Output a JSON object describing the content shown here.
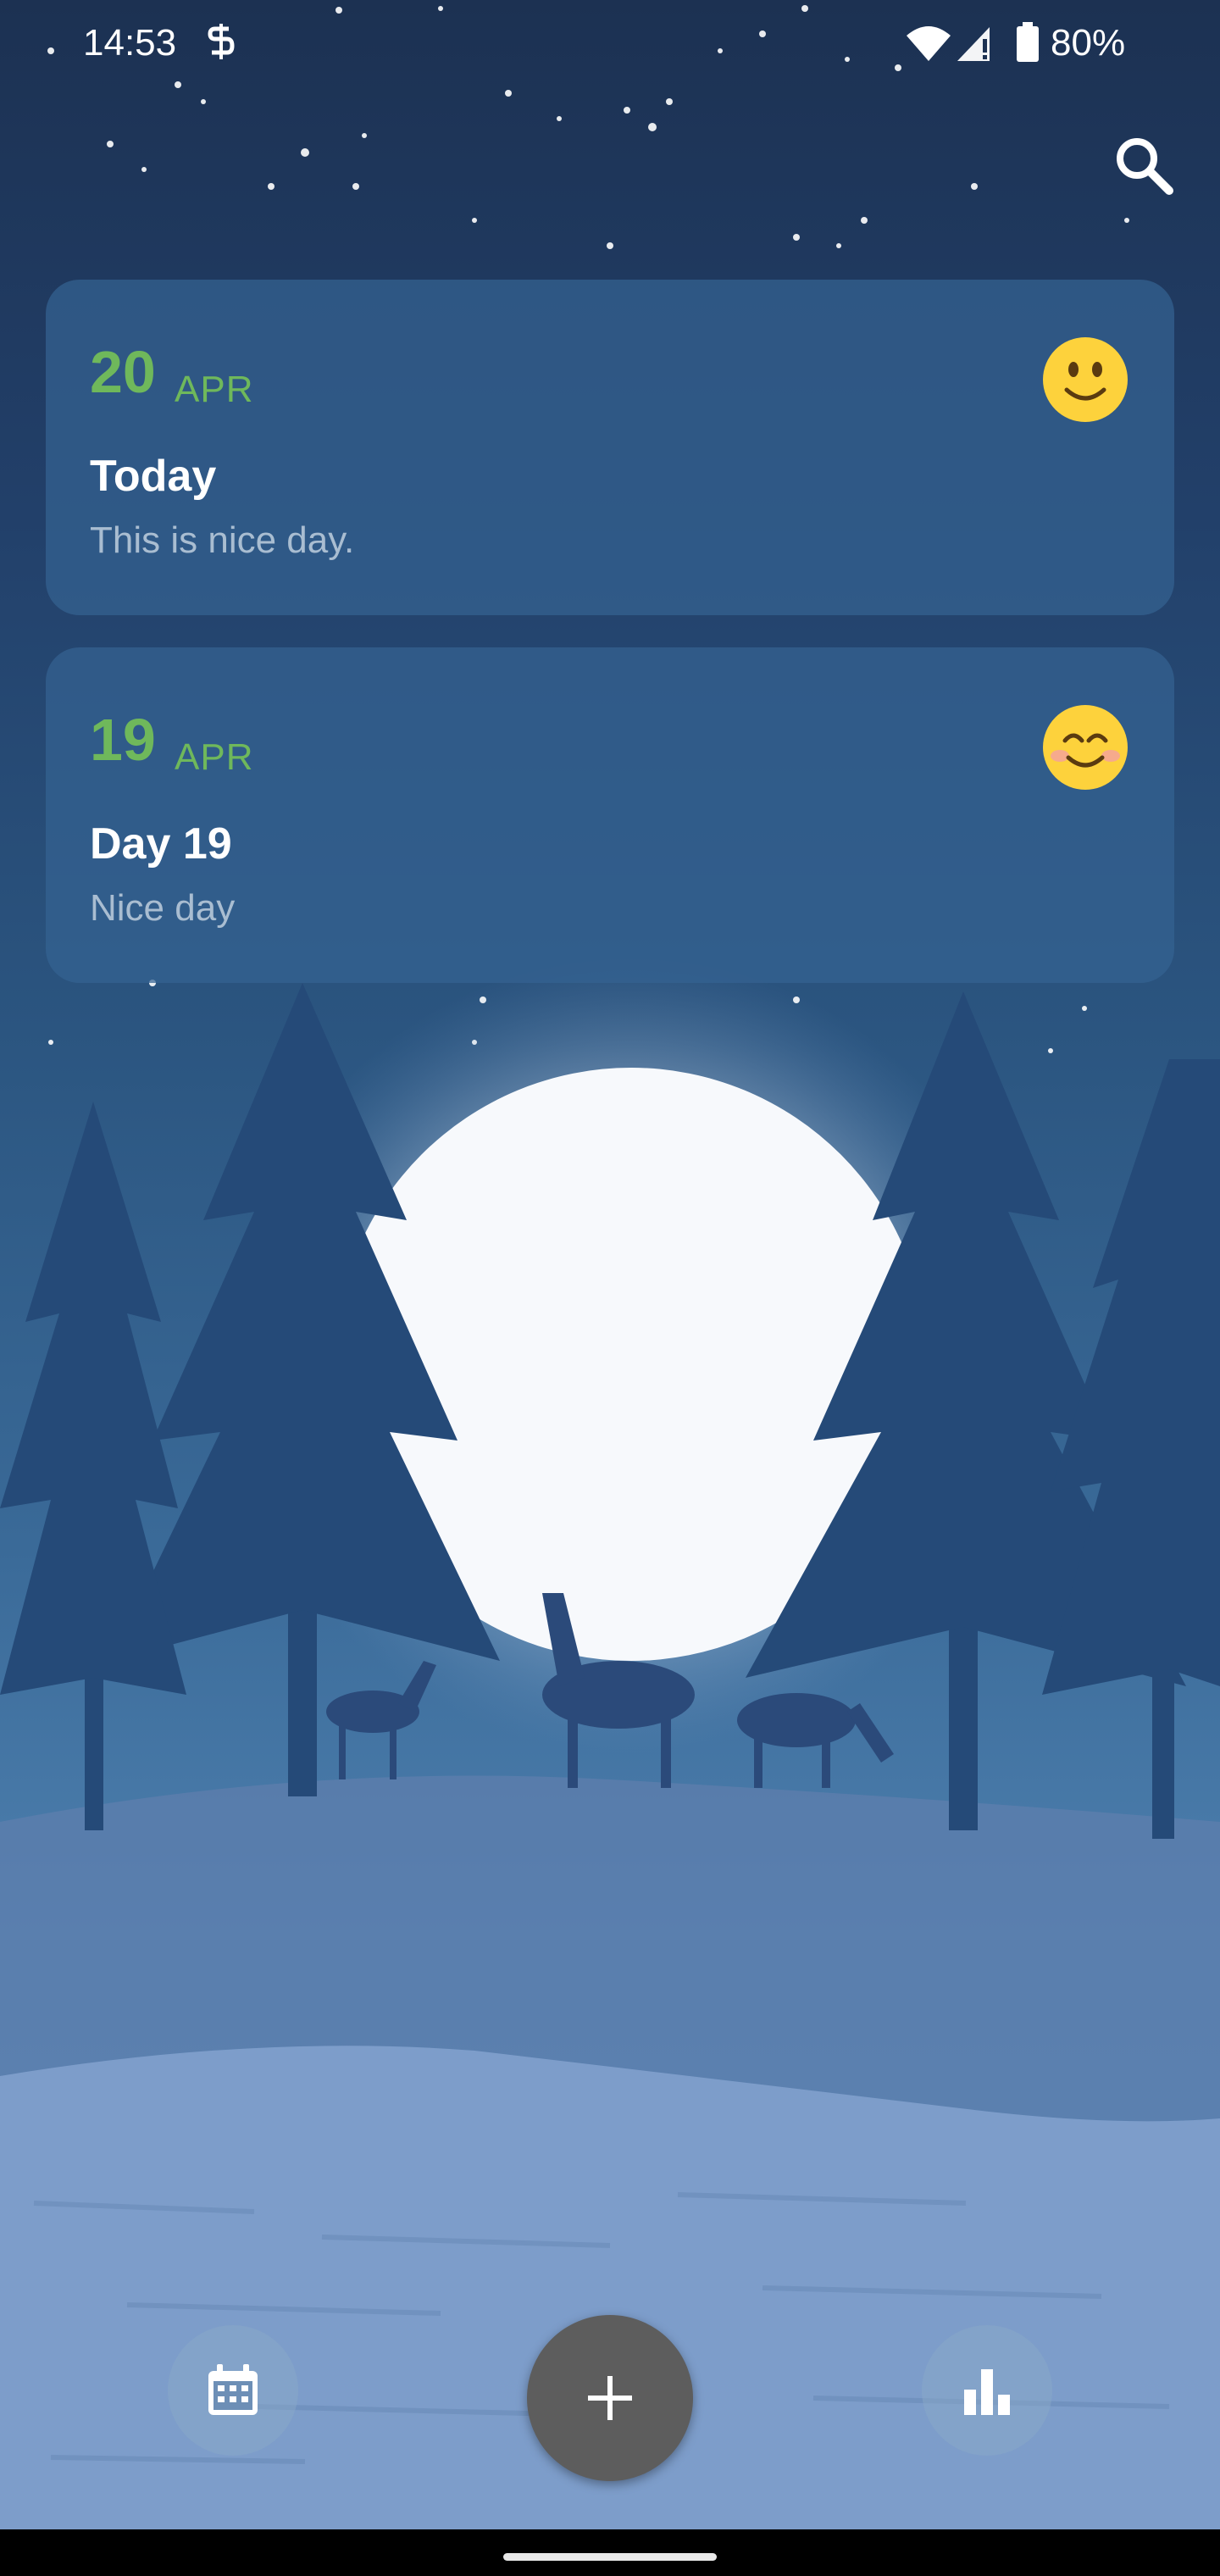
{
  "status_bar": {
    "time": "14:53",
    "battery": "80%"
  },
  "header": {
    "search_icon": "search-icon"
  },
  "entries": [
    {
      "day": "20",
      "month": "APR",
      "title": "Today",
      "body": "This is nice day.",
      "mood_icon": "slightly-smiling-face-icon"
    },
    {
      "day": "19",
      "month": "APR",
      "title": "Day 19",
      "body": "Nice day",
      "mood_icon": "smiling-face-with-smiling-eyes-icon"
    }
  ],
  "bottom_bar": {
    "calendar_icon": "calendar-icon",
    "add_icon": "plus-icon",
    "stats_icon": "bar-chart-icon"
  },
  "colors": {
    "date_accent": "#6fb85b",
    "card_bg": "#346291",
    "fab_bg": "#5d5d5d"
  }
}
